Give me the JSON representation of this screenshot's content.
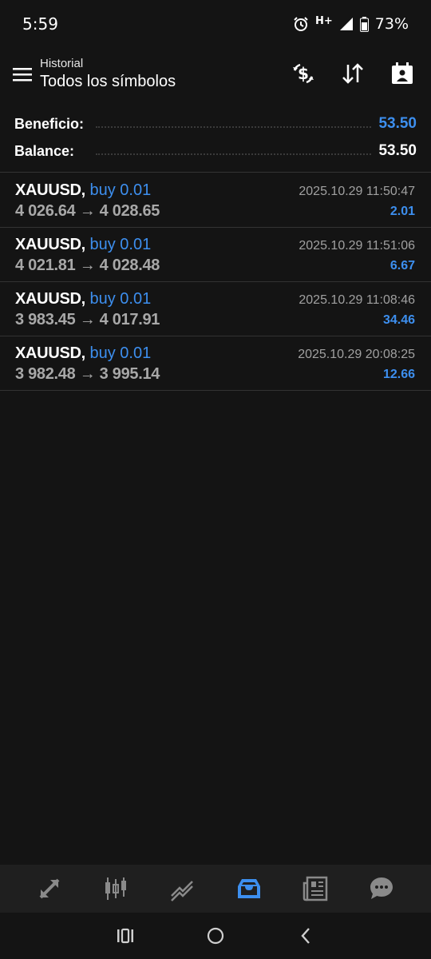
{
  "status": {
    "time": "5:59",
    "network": "H+",
    "battery": "73%"
  },
  "header": {
    "subtitle": "Historial",
    "title": "Todos los símbolos"
  },
  "summary": {
    "profit_label": "Beneficio:",
    "profit_value": "53.50",
    "balance_label": "Balance:",
    "balance_value": "53.50"
  },
  "trades": [
    {
      "symbol": "XAUUSD,",
      "type": "buy 0.01",
      "prices": "4 026.64 → 4 028.65",
      "time": "2025.10.29 11:50:47",
      "profit": "2.01"
    },
    {
      "symbol": "XAUUSD,",
      "type": "buy 0.01",
      "prices": "4 021.81 → 4 028.48",
      "time": "2025.10.29 11:51:06",
      "profit": "6.67"
    },
    {
      "symbol": "XAUUSD,",
      "type": "buy 0.01",
      "prices": "3 983.45 → 4 017.91",
      "time": "2025.10.29 11:08:46",
      "profit": "34.46"
    },
    {
      "symbol": "XAUUSD,",
      "type": "buy 0.01",
      "prices": "3 982.48 → 3 995.14",
      "time": "2025.10.29 20:08:25",
      "profit": "12.66"
    }
  ],
  "nav": {
    "items": [
      "quotes-icon",
      "chart-icon",
      "trade-icon",
      "history-icon",
      "news-icon",
      "chat-icon"
    ],
    "active": "history-icon"
  },
  "colors": {
    "accent": "#3d8fef",
    "background": "#141414",
    "nav_background": "#1f1f1f"
  }
}
